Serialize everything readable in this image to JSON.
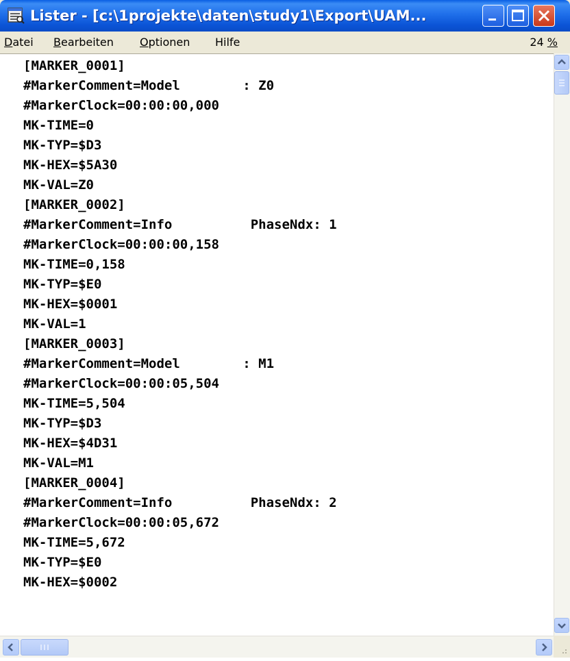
{
  "window": {
    "title": "Lister - [c:\\1projekte\\daten\\study1\\Export\\UAM...",
    "icon": "lister-app-icon"
  },
  "menu": {
    "items": [
      {
        "label_rest": "atei",
        "accel": "D"
      },
      {
        "label_rest": "earbeiten",
        "accel": "B"
      },
      {
        "label_rest": "ptionen",
        "accel": "O"
      },
      {
        "label": "Hilfe"
      }
    ],
    "zoom_value": "24",
    "zoom_unit": "%"
  },
  "content": {
    "lines": [
      "[MARKER_0001]",
      "#MarkerComment=Model        : Z0",
      "#MarkerClock=00:00:00,000",
      "MK-TIME=0",
      "MK-TYP=$D3",
      "MK-HEX=$5A30",
      "MK-VAL=Z0",
      "[MARKER_0002]",
      "#MarkerComment=Info          PhaseNdx: 1",
      "#MarkerClock=00:00:00,158",
      "MK-TIME=0,158",
      "MK-TYP=$E0",
      "MK-HEX=$0001",
      "MK-VAL=1",
      "[MARKER_0003]",
      "#MarkerComment=Model        : M1",
      "#MarkerClock=00:00:05,504",
      "MK-TIME=5,504",
      "MK-TYP=$D3",
      "MK-HEX=$4D31",
      "MK-VAL=M1",
      "[MARKER_0004]",
      "#MarkerComment=Info          PhaseNdx: 2",
      "#MarkerClock=00:00:05,672",
      "MK-TIME=5,672",
      "MK-TYP=$E0",
      "MK-HEX=$0002"
    ]
  },
  "colors": {
    "titlebar": "#0a54d6",
    "close_button": "#d9492b",
    "background": "#ffffff"
  }
}
